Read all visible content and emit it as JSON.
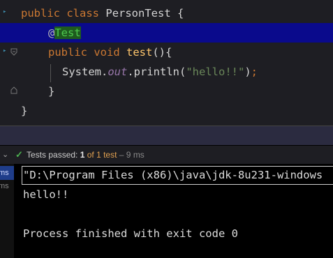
{
  "editor": {
    "line1": {
      "kw1": "public",
      "kw2": "class",
      "name": "PersonTest",
      "brace": "{"
    },
    "line2": {
      "at": "@",
      "annotation": "Test"
    },
    "line3": {
      "kw1": "public",
      "kw2": "void",
      "method": "test",
      "parens": "(){"
    },
    "line4": {
      "obj": "System.",
      "field": "out",
      "call": ".println(",
      "string": "\"hello!!\"",
      "close": ")",
      "semi": ";"
    },
    "line5": {
      "brace": "}"
    },
    "line6": {
      "brace": "}"
    }
  },
  "run": {
    "label": "Tests passed:",
    "passed": "1",
    "of_text": "of 1 test",
    "time": "– 9 ms"
  },
  "left_items": [
    "ms",
    "ms"
  ],
  "console": {
    "command": "\"D:\\Program Files (x86)\\java\\jdk-8u231-windows",
    "output": "hello!!",
    "exit": "Process finished with exit code 0"
  },
  "colors": {
    "keyword": "#cc7832",
    "annotation": "#4ec94e",
    "method": "#ffc66d",
    "string": "#6a8759",
    "highlight": "#0a0a8c",
    "pass": "#4caf50"
  }
}
